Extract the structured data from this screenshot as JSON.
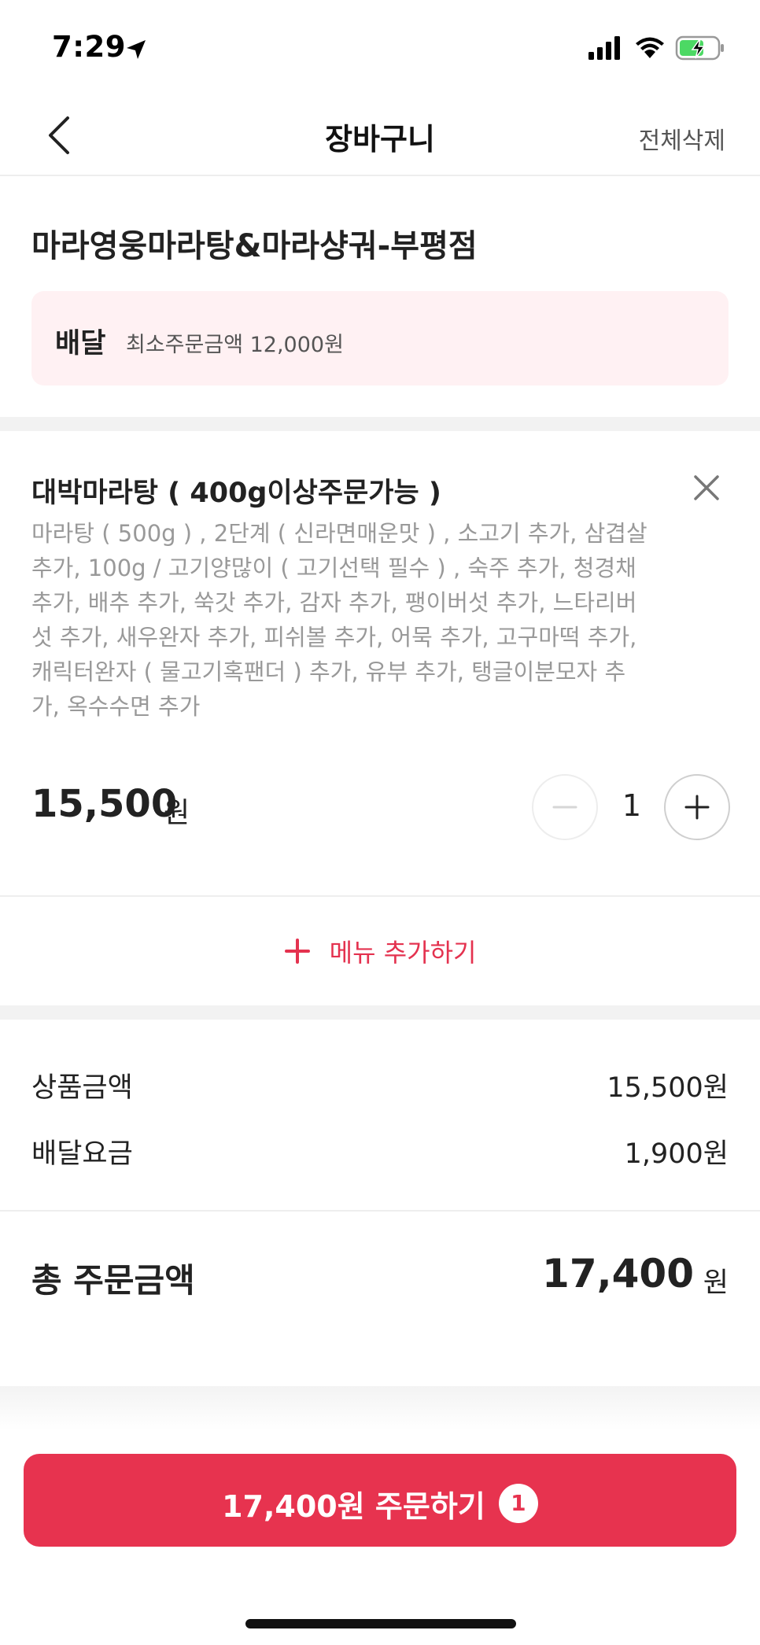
{
  "status_bar": {
    "time": "7:29"
  },
  "nav": {
    "title": "장바구니",
    "clear_all": "전체삭제"
  },
  "store": {
    "name": "마라영웅마라탕&마라샹궈-부평점",
    "delivery_label": "배달",
    "min_order": "최소주문금액 12,000원"
  },
  "cart_item": {
    "title": "대박마라탕 ( 400g이상주문가능 )",
    "options_lines": [
      "마라탕 ( 500g ) , 2단계 ( 신라면매운맛 ) , 소고기 추가, 삼겹살",
      "추가, 100g / 고기양많이 ( 고기선택 필수 ) , 숙주 추가, 청경채",
      "추가, 배추 추가, 쑥갓 추가, 감자 추가, 팽이버섯 추가, 느타리버",
      "섯 추가, 새우완자 추가, 피쉬볼 추가, 어묵 추가, 고구마떡 추가,",
      "캐릭터완자 ( 물고기혹팬더 ) 추가, 유부 추가, 탱글이분모자 추",
      "가, 옥수수면 추가"
    ],
    "price": "15,500",
    "price_unit": "원",
    "quantity": "1"
  },
  "add_menu_label": "메뉴 추가하기",
  "summary": {
    "product_amount_label": "상품금액",
    "product_amount_value": "15,500원",
    "delivery_fee_label": "배달요금",
    "delivery_fee_value": "1,900원",
    "total_label": "총 주문금액",
    "total_value": "17,400",
    "total_unit": "원"
  },
  "order_button": {
    "label": "17,400원 주문하기",
    "badge": "1"
  },
  "colors": {
    "accent": "#e7334f",
    "delivery_box_bg": "#fff1f3",
    "battery_green": "#4cd964"
  },
  "icons": [
    "location-arrow-icon",
    "signal-icon",
    "wifi-icon",
    "battery-charging-icon",
    "back-arrow-icon",
    "close-icon",
    "minus-icon",
    "plus-icon"
  ]
}
